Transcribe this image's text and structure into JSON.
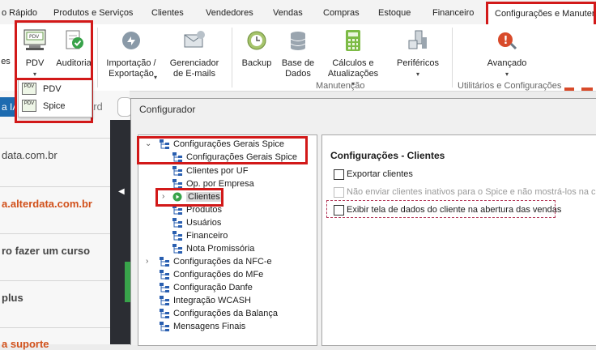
{
  "tabs": [
    "o Rápido",
    "Produtos e Serviços",
    "Clientes",
    "Vendedores",
    "Vendas",
    "Compras",
    "Estoque",
    "Financeiro",
    "Configurações e Manutenç"
  ],
  "ribbon": {
    "items": {
      "prev": "es",
      "pdv": "PDV",
      "auditoria": "Auditoria",
      "importacao_1": "Importação /",
      "importacao_2": "Exportação",
      "email_1": "Gerenciador",
      "email_2": "de E-mails",
      "backup": "Backup",
      "base_1": "Base de",
      "base_2": "Dados",
      "calc_1": "Cálculos e",
      "calc_2": "Atualizações",
      "perifericos": "Periféricos",
      "avancado": "Avançado"
    },
    "groups": {
      "manutencao": "Manutenção",
      "utilitarios": "Utilitários e Configurações"
    }
  },
  "pdv_menu": [
    {
      "label": "PDV"
    },
    {
      "label": "Spice"
    }
  ],
  "background_page": {
    "button_fragment": "a IA",
    "field_fragment": "ard",
    "texts": [
      "data.com.br",
      "a.alterdata.com.br",
      "ro fazer um curso",
      "plus",
      "a suporte"
    ]
  },
  "dialog": {
    "title": "Configurador",
    "tree": [
      {
        "label": "Configurações Gerais Spice"
      },
      {
        "label": "Configurações Gerais Spice"
      },
      {
        "label": "Clientes por UF"
      },
      {
        "label": "Op. por Empresa"
      },
      {
        "label": "Clientes"
      },
      {
        "label": "Produtos"
      },
      {
        "label": "Usuários"
      },
      {
        "label": "Financeiro"
      },
      {
        "label": "Nota Promissória"
      },
      {
        "label": "Configurações da NFC-e"
      },
      {
        "label": "Configurações do MFe"
      },
      {
        "label": "Configuração Danfe"
      },
      {
        "label": "Integração WCASH"
      },
      {
        "label": "Configurações da Balança"
      },
      {
        "label": "Mensagens Finais"
      }
    ],
    "content": {
      "heading": "Configurações - Clientes",
      "options": [
        {
          "label": "Exportar clientes",
          "checked": false,
          "enabled": true
        },
        {
          "label": "Não enviar clientes inativos para o Spice e não mostrá-los na con",
          "checked": false,
          "enabled": false
        },
        {
          "label": "Exibir tela de dados do cliente na abertura das vendas",
          "checked": false,
          "enabled": true
        }
      ]
    }
  },
  "colors": {
    "highlight_red": "#d21919",
    "accent_green": "#38a34a",
    "dark_strip": "#2b2d33",
    "link_orange": "#d1501a"
  }
}
